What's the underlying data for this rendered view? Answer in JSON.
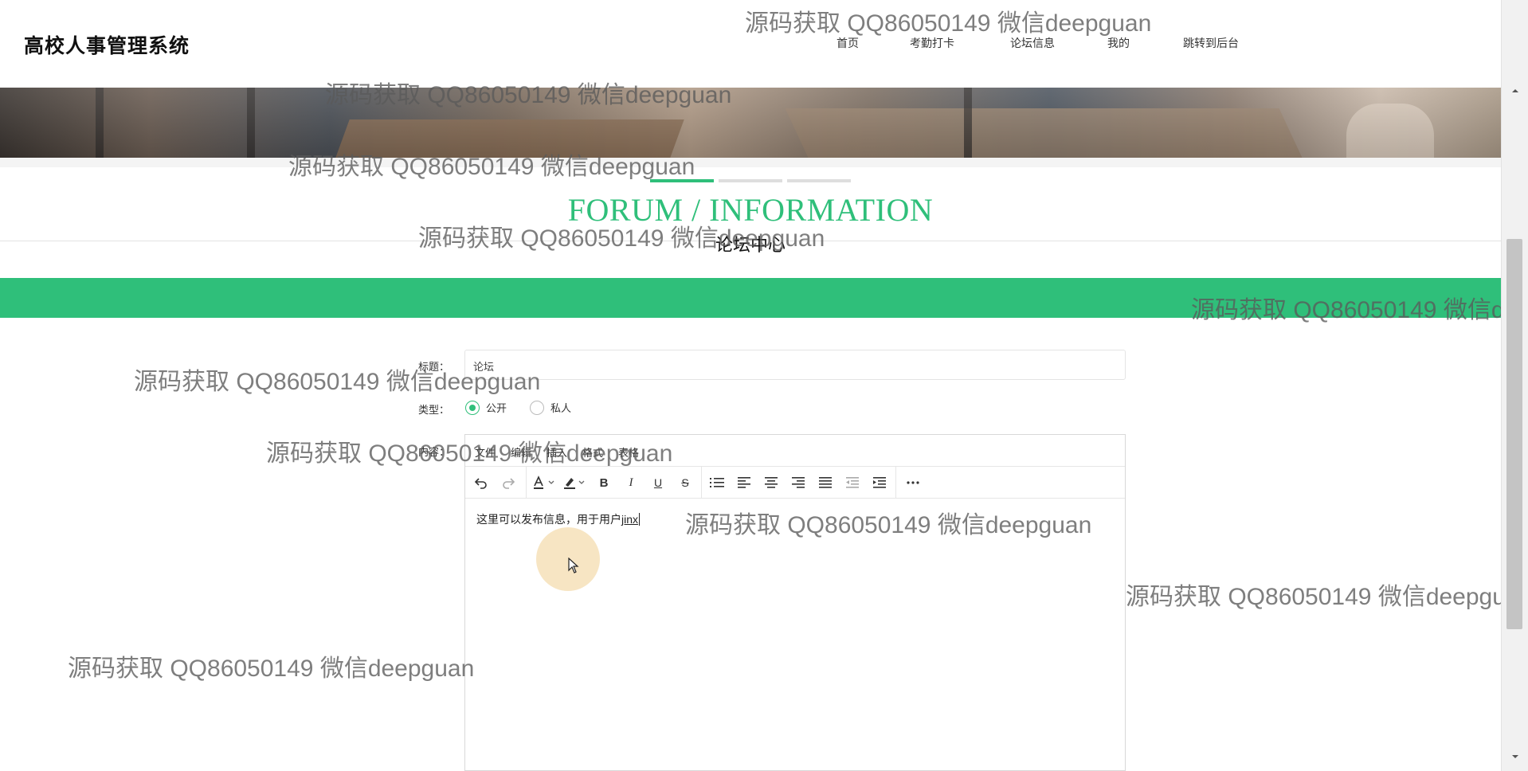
{
  "header": {
    "site_title": "高校人事管理系统",
    "nav": [
      "首页",
      "考勤打卡",
      "论坛信息",
      "我的",
      "跳转到后台"
    ]
  },
  "section": {
    "title": "FORUM / INFORMATION",
    "subtitle": "论坛中心"
  },
  "carousel": {
    "count": 3,
    "active_index": 0
  },
  "form": {
    "title_label": "标题：",
    "title_value": "论坛",
    "type_label": "类型：",
    "type_options": [
      "公开",
      "私人"
    ],
    "type_selected": "公开",
    "content_label": "内容：",
    "editor": {
      "menus": [
        "文件",
        "编辑",
        "插入",
        "格式",
        "表格"
      ],
      "toolbar": [
        "undo-icon",
        "redo-icon",
        "font-color-icon",
        "highlight-icon",
        "bold-icon",
        "italic-icon",
        "underline-icon",
        "strikethrough-icon",
        "list-icon",
        "align-left-icon",
        "align-center-icon",
        "align-right-icon",
        "align-justify-icon",
        "outdent-icon",
        "indent-icon",
        "more-icon"
      ],
      "content_text": "这里可以发布信息，用于用户",
      "content_typing": "jinx"
    }
  },
  "watermark": "源码获取 QQ86050149 微信deepguan",
  "colors": {
    "accent": "#2fbf7a"
  }
}
